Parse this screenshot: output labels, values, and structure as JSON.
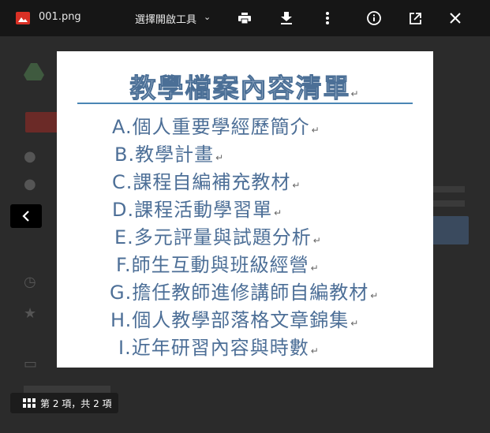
{
  "toolbar": {
    "file_name": "001.png",
    "open_with": "選擇開啟工具",
    "chevron": "⌄"
  },
  "image": {
    "title": "教學檔案內容清單",
    "paragraph_mark": "↵",
    "items": [
      {
        "letter": "A.",
        "text": "個人重要學經歷簡介"
      },
      {
        "letter": "B.",
        "text": "教學計畫"
      },
      {
        "letter": "C.",
        "text": "課程自編補充教材"
      },
      {
        "letter": "D.",
        "text": "課程活動學習單"
      },
      {
        "letter": "E.",
        "text": "多元評量與試題分析"
      },
      {
        "letter": "F.",
        "text": "師生互動與班級經營"
      },
      {
        "letter": "G.",
        "text": "擔任教師進修講師自編教材"
      },
      {
        "letter": "H.",
        "text": "個人教學部落格文章錦集"
      },
      {
        "letter": "I.",
        "text": "近年研習內容與時數"
      }
    ]
  },
  "pager": {
    "counter": "第 2 項，共 2 項"
  },
  "colors": {
    "accent_red": "#d93025",
    "doc_text": "#4d6f97",
    "rule": "#4a86b4"
  }
}
